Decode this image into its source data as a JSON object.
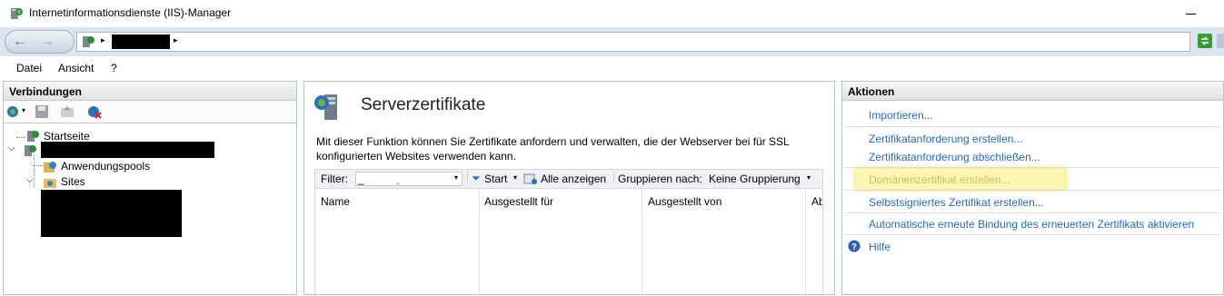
{
  "window": {
    "title": "Internetinformationsdienste (IIS)-Manager"
  },
  "address": {
    "separator": "▸"
  },
  "menu": {
    "items": [
      "Datei",
      "Ansicht",
      "?"
    ]
  },
  "connections": {
    "header": "Verbindungen",
    "tree": {
      "start": "Startseite",
      "app_pools": "Anwendungspools",
      "sites": "Sites"
    }
  },
  "feature": {
    "title": "Serverzertifikate",
    "description": "Mit dieser Funktion können Sie Zertifikate anfordern und verwalten, die der Webserver bei für SSL konfigurierten Websites verwenden kann.",
    "filter_label": "Filter:",
    "filter_value": "_",
    "start_label": "Start",
    "show_all_label": "Alle anzeigen",
    "group_by_label": "Gruppieren nach:",
    "group_by_value": "Keine Gruppierung",
    "columns": [
      "Name",
      "Ausgestellt für",
      "Ausgestellt von",
      "Ab"
    ]
  },
  "actions": {
    "header": "Aktionen",
    "import": "Importieren...",
    "create_request": "Zertifikatanforderung erstellen...",
    "complete_request": "Zertifikatanforderung abschließen...",
    "create_domain": "Domänenzertifikat erstellen...",
    "create_self_signed": "Selbstsigniertes Zertifikat erstellen...",
    "auto_rebind": "Automatische erneute Bindung des erneuerten Zertifikats aktivieren",
    "help": "Hilfe"
  },
  "colors": {
    "link": "#2a69b4",
    "highlight": "#fbf6b4",
    "redaction": "#000000"
  }
}
